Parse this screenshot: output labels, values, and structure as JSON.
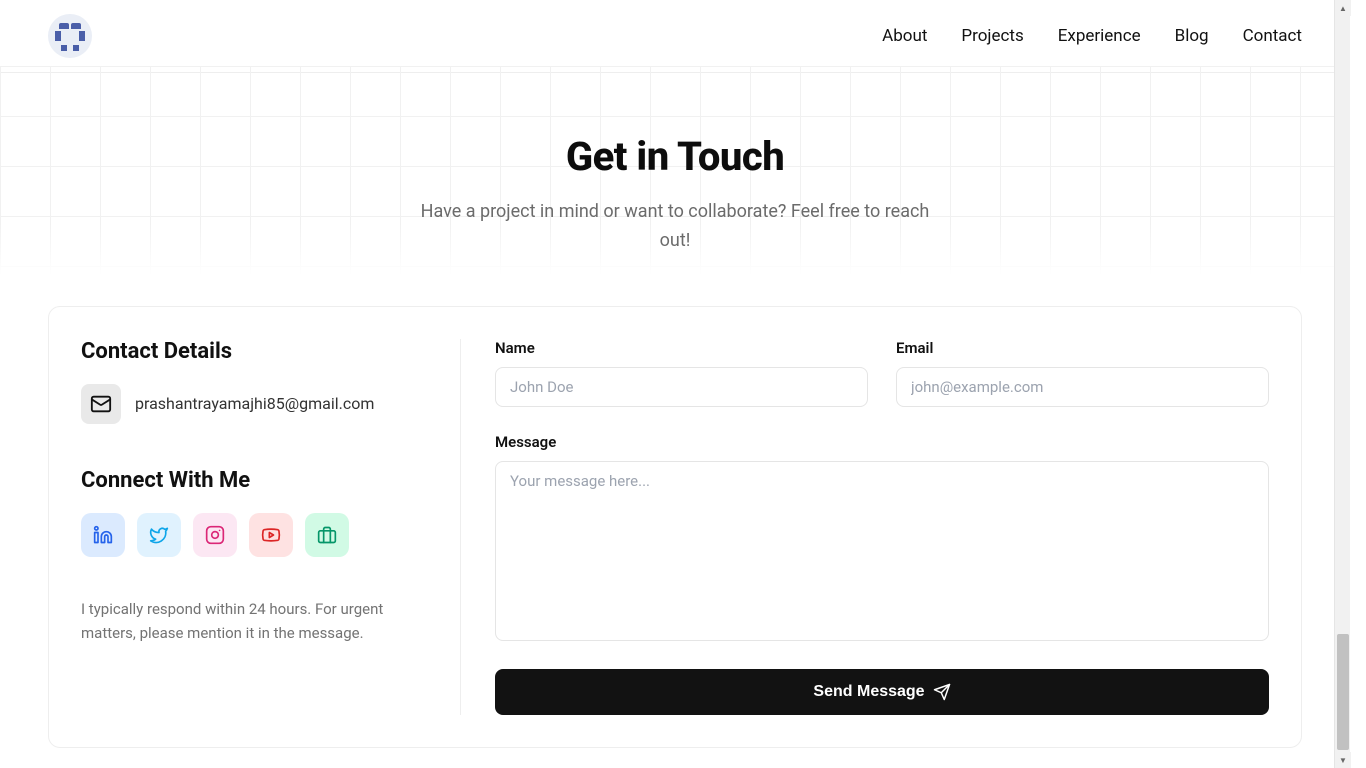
{
  "nav": {
    "items": [
      "About",
      "Projects",
      "Experience",
      "Blog",
      "Contact"
    ]
  },
  "hero": {
    "title": "Get in Touch",
    "subtitle": "Have a project in mind or want to collaborate? Feel free to reach out!"
  },
  "contact": {
    "details_heading": "Contact Details",
    "email": "prashantrayamajhi85@gmail.com",
    "connect_heading": "Connect With Me",
    "note": "I typically respond within 24 hours. For urgent matters, please mention it in the message."
  },
  "socials": {
    "linkedin": "linkedin-icon",
    "twitter": "twitter-icon",
    "instagram": "instagram-icon",
    "youtube": "youtube-icon",
    "briefcase": "briefcase-icon"
  },
  "form": {
    "name_label": "Name",
    "name_placeholder": "John Doe",
    "email_label": "Email",
    "email_placeholder": "john@example.com",
    "message_label": "Message",
    "message_placeholder": "Your message here...",
    "submit_label": "Send Message"
  }
}
